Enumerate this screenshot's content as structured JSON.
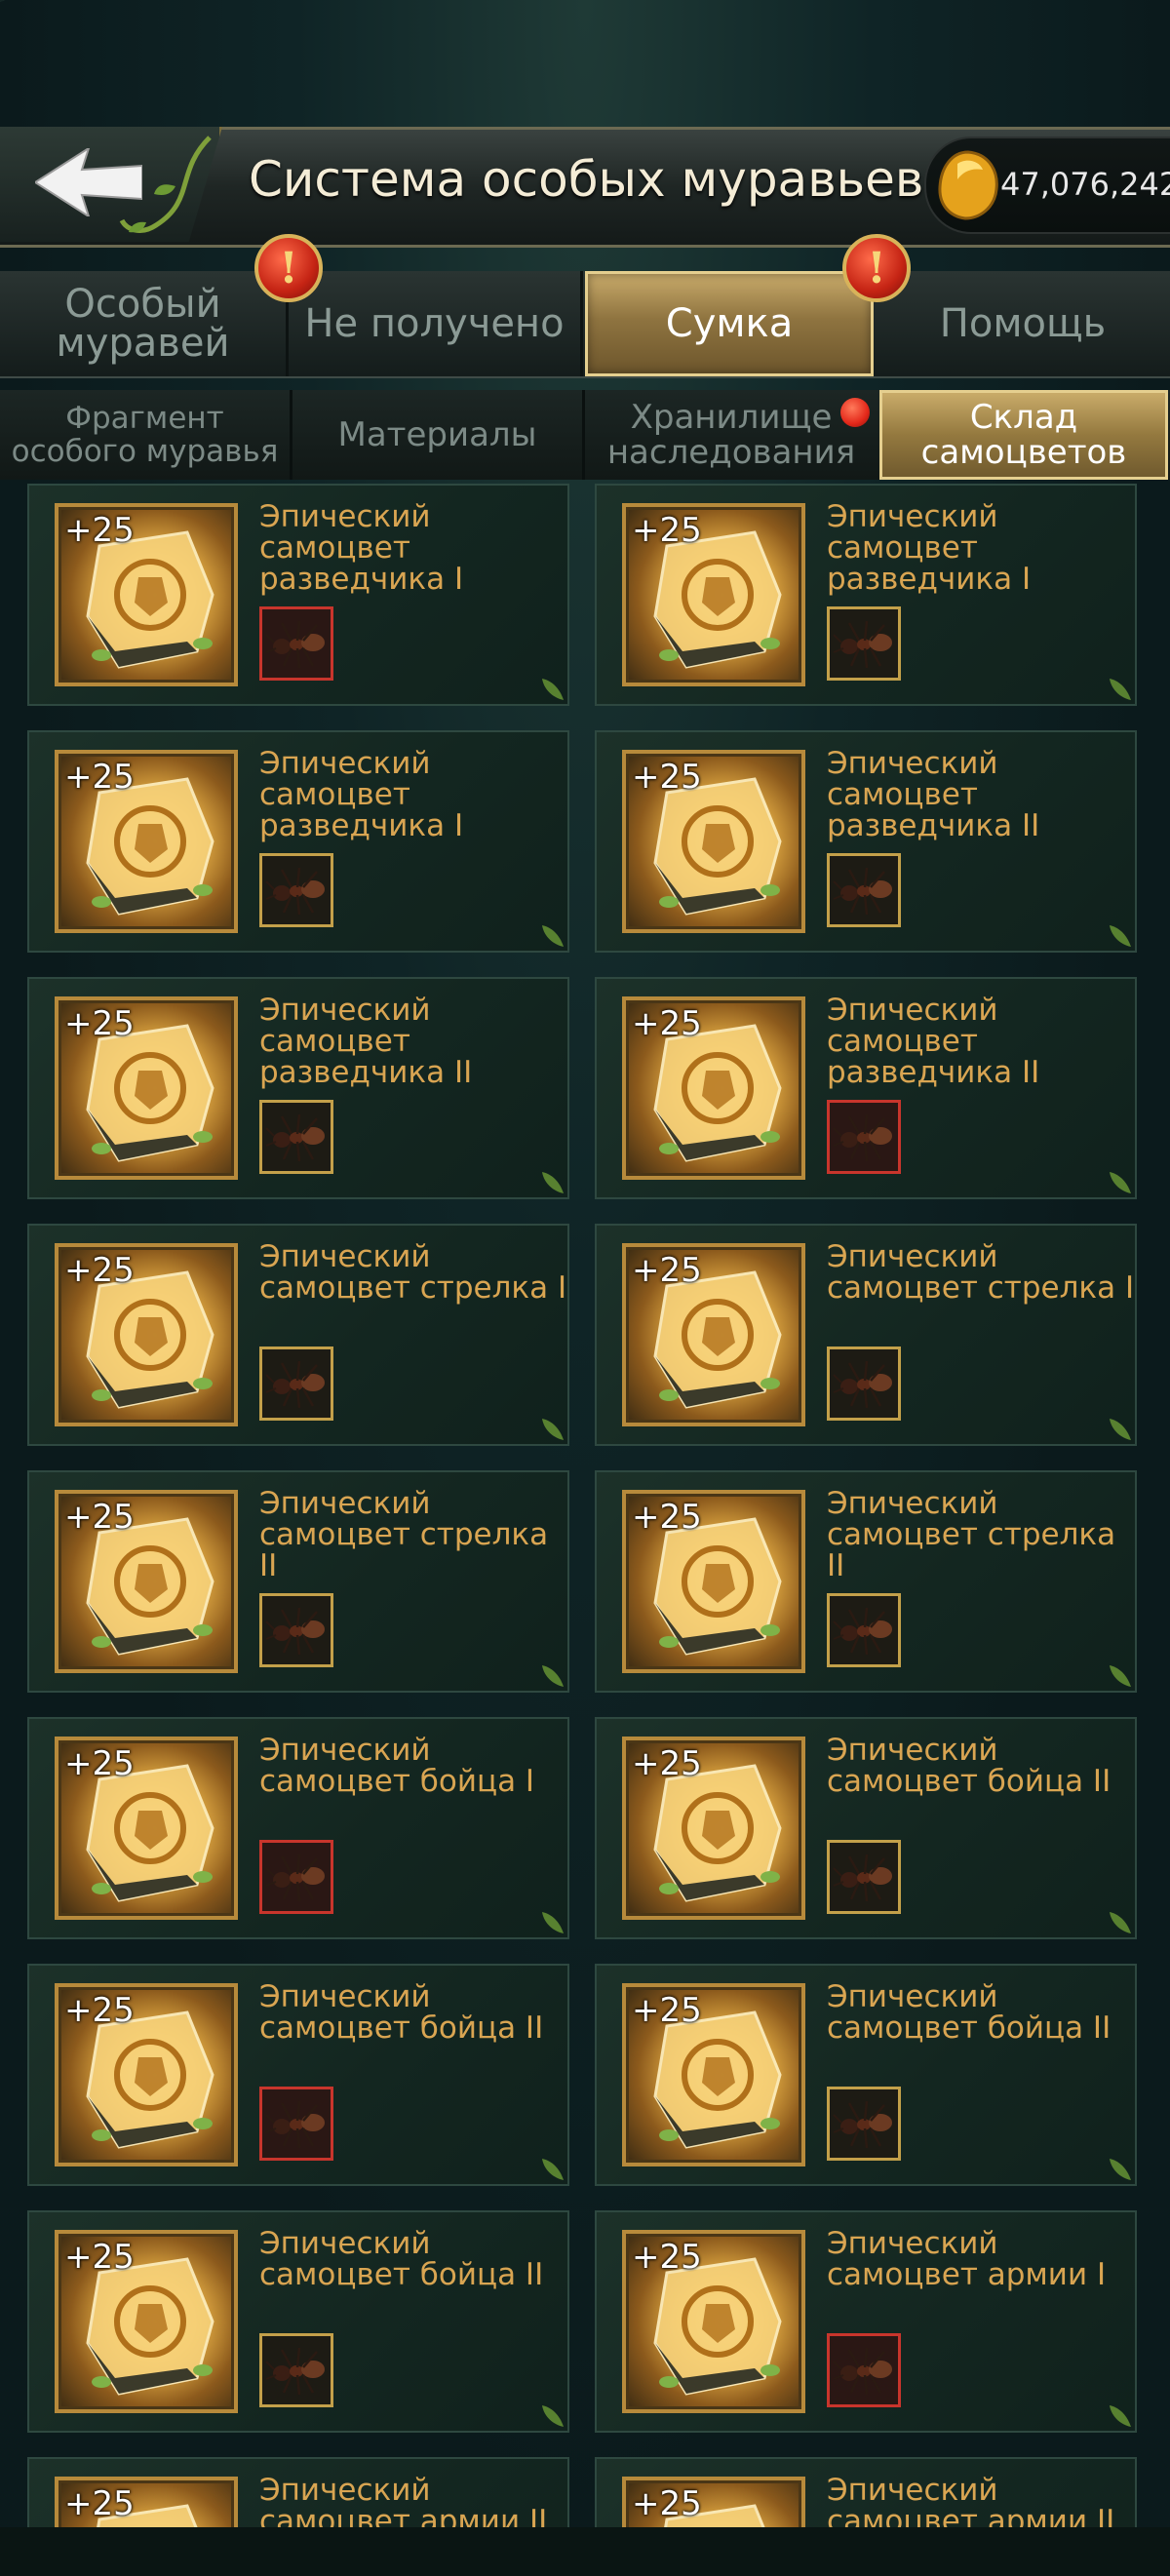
{
  "header": {
    "title": "Система особых муравьев",
    "currency_amount": "47,076,242",
    "back_icon": "back-arrow-icon",
    "currency_icon": "amber-gem-icon"
  },
  "tabs_main": [
    {
      "label": "Особый муравей",
      "active": false,
      "alert": false
    },
    {
      "label": "Не получено",
      "active": false,
      "alert": true
    },
    {
      "label": "Сумка",
      "active": true,
      "alert": true
    },
    {
      "label": "Помощь",
      "active": false,
      "alert": false
    }
  ],
  "tabs_sub": [
    {
      "label": "Фрагмент особого муравья",
      "active": false,
      "dot": false
    },
    {
      "label": "Материалы",
      "active": false,
      "dot": false
    },
    {
      "label": "Хранилище наследования",
      "active": false,
      "dot": true
    },
    {
      "label": "Склад самоцветов",
      "active": true,
      "dot": false
    }
  ],
  "items": [
    {
      "plus": "+25",
      "name": "Эпический самоцвет разведчика I",
      "ant_frame": "red"
    },
    {
      "plus": "+25",
      "name": "Эпический самоцвет разведчика I",
      "ant_frame": "gold"
    },
    {
      "plus": "+25",
      "name": "Эпический самоцвет разведчика I",
      "ant_frame": "gold"
    },
    {
      "plus": "+25",
      "name": "Эпический самоцвет разведчика II",
      "ant_frame": "gold"
    },
    {
      "plus": "+25",
      "name": "Эпический самоцвет разведчика II",
      "ant_frame": "gold"
    },
    {
      "plus": "+25",
      "name": "Эпический самоцвет разведчика II",
      "ant_frame": "red"
    },
    {
      "plus": "+25",
      "name": "Эпический самоцвет стрелка I",
      "ant_frame": "gold"
    },
    {
      "plus": "+25",
      "name": "Эпический самоцвет стрелка I",
      "ant_frame": "gold"
    },
    {
      "plus": "+25",
      "name": "Эпический самоцвет стрелка II",
      "ant_frame": "gold"
    },
    {
      "plus": "+25",
      "name": "Эпический самоцвет стрелка II",
      "ant_frame": "gold"
    },
    {
      "plus": "+25",
      "name": "Эпический самоцвет бойца I",
      "ant_frame": "red"
    },
    {
      "plus": "+25",
      "name": "Эпический самоцвет бойца II",
      "ant_frame": "gold"
    },
    {
      "plus": "+25",
      "name": "Эпический самоцвет бойца II",
      "ant_frame": "red"
    },
    {
      "plus": "+25",
      "name": "Эпический самоцвет бойца II",
      "ant_frame": "gold"
    },
    {
      "plus": "+25",
      "name": "Эпический самоцвет бойца II",
      "ant_frame": "gold"
    },
    {
      "plus": "+25",
      "name": "Эпический самоцвет армии I",
      "ant_frame": "red"
    },
    {
      "plus": "+25",
      "name": "Эпический самоцвет армии II",
      "ant_frame": "gold"
    },
    {
      "plus": "+25",
      "name": "Эпический самоцвет армии II",
      "ant_frame": "gold"
    }
  ]
}
